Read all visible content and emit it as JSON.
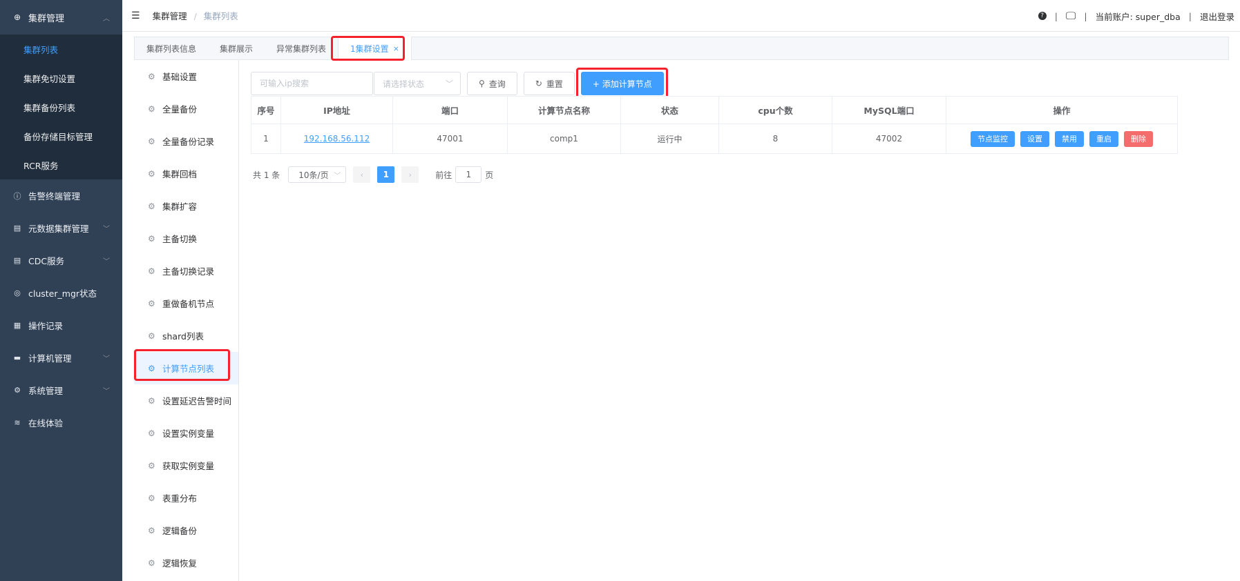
{
  "sidebar": {
    "group_title": "集群管理",
    "subitems": [
      "集群列表",
      "集群免切设置",
      "集群备份列表",
      "备份存储目标管理",
      "RCR服务"
    ],
    "items": [
      {
        "label": "告警终端管理",
        "icon": "alert-circle-icon",
        "glyph": "ⓘ"
      },
      {
        "label": "元数据集群管理",
        "icon": "document-icon",
        "glyph": "▤"
      },
      {
        "label": "CDC服务",
        "icon": "document-icon",
        "glyph": "▤"
      },
      {
        "label": "cluster_mgr状态",
        "icon": "aperture-icon",
        "glyph": "◎"
      },
      {
        "label": "操作记录",
        "icon": "record-icon",
        "glyph": "▦"
      },
      {
        "label": "计算机管理",
        "icon": "monitor-icon",
        "glyph": "▬"
      },
      {
        "label": "系统管理",
        "icon": "gear-icon",
        "glyph": "⚙"
      },
      {
        "label": "在线体验",
        "icon": "database-icon",
        "glyph": "≋"
      }
    ]
  },
  "header": {
    "breadcrumb_root": "集群管理",
    "breadcrumb_sep": "/",
    "breadcrumb_current": "集群列表",
    "account_label": "当前账户: super_dba",
    "logout": "退出登录",
    "divider": "|"
  },
  "tabs": [
    "集群列表信息",
    "集群展示",
    "异常集群列表",
    "1集群设置"
  ],
  "tab_close": "×",
  "settings_menu": [
    "基础设置",
    "全量备份",
    "全量备份记录",
    "集群回档",
    "集群扩容",
    "主备切换",
    "主备切换记录",
    "重做备机节点",
    "shard列表",
    "计算节点列表",
    "设置延迟告警时间",
    "设置实例变量",
    "获取实例变量",
    "表重分布",
    "逻辑备份",
    "逻辑恢复"
  ],
  "toolbar": {
    "ip_placeholder": "可输入ip搜索",
    "status_placeholder": "请选择状态",
    "query": "查询",
    "reset": "重置",
    "add": "+ 添加计算节点"
  },
  "table": {
    "headers": [
      "序号",
      "IP地址",
      "端口",
      "计算节点名称",
      "状态",
      "cpu个数",
      "MySQL端口",
      "操作"
    ],
    "rows": [
      {
        "index": "1",
        "ip": "192.168.56.112",
        "port": "47001",
        "name": "comp1",
        "status": "运行中",
        "cpu": "8",
        "mysql_port": "47002"
      }
    ],
    "actions": [
      "节点监控",
      "设置",
      "禁用",
      "重启",
      "删除"
    ]
  },
  "pagination": {
    "total": "共 1 条",
    "page_size": "10条/页",
    "prev": "‹",
    "next": "›",
    "current": "1",
    "goto_prefix": "前往",
    "goto_value": "1",
    "goto_suffix": "页"
  }
}
